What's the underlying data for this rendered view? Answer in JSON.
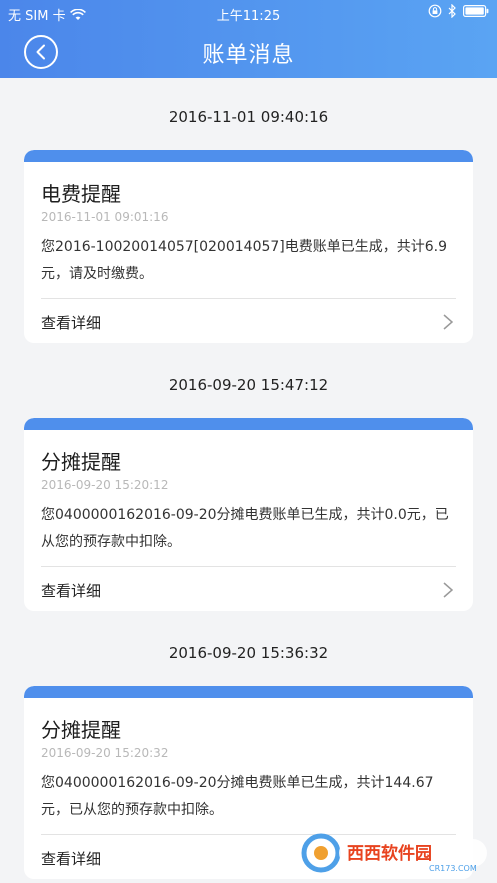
{
  "status_bar": {
    "carrier": "无 SIM 卡",
    "time": "上午11:25"
  },
  "header": {
    "title": "账单消息"
  },
  "messages": [
    {
      "date_header": "2016-11-01 09:40:16",
      "title": "电费提醒",
      "time": "2016-11-01 09:01:16",
      "body": "您2016-10020014057[020014057]电费账单已生成，共计6.9元，请及时缴费。",
      "link": "查看详细"
    },
    {
      "date_header": "2016-09-20 15:47:12",
      "title": "分摊提醒",
      "time": "2016-09-20 15:20:12",
      "body": "您0400000162016-09-20分摊电费账单已生成，共计0.0元，已从您的预存款中扣除。",
      "link": "查看详细"
    },
    {
      "date_header": "2016-09-20 15:36:32",
      "title": "分摊提醒",
      "time": "2016-09-20 15:20:32",
      "body": "您0400000162016-09-20分摊电费账单已生成，共计144.67元，已从您的预存款中扣除。",
      "link": "查看详细"
    }
  ],
  "watermark": {
    "text": "西西软件园",
    "sub": "CR173.COM"
  },
  "colors": {
    "header_start": "#4b86ea",
    "header_end": "#5aa4f3",
    "card_accent": "#4f8fec",
    "page_bg": "#f3f4f6"
  }
}
